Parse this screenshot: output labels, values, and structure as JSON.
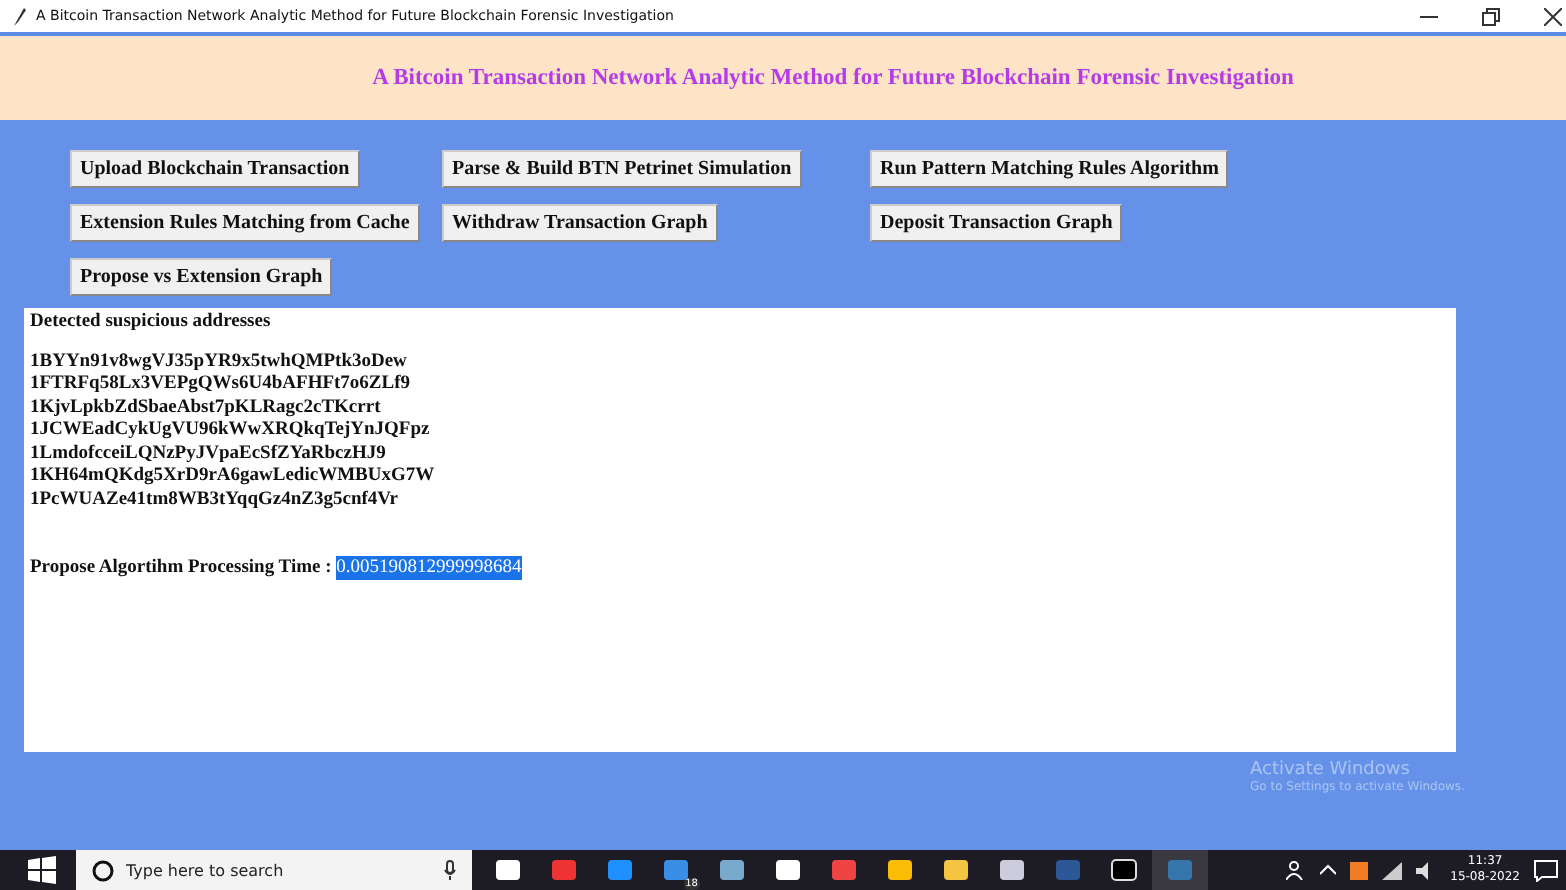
{
  "window": {
    "title": "A Bitcoin Transaction Network Analytic Method for Future Blockchain Forensic Investigation"
  },
  "header": {
    "title": "A Bitcoin Transaction Network Analytic Method for Future Blockchain Forensic Investigation"
  },
  "buttons": [
    {
      "label": "Upload Blockchain Transaction"
    },
    {
      "label": "Parse & Build BTN Petrinet Simulation"
    },
    {
      "label": "Run Pattern Matching Rules Algorithm"
    },
    {
      "label": "Extension Rules Matching from Cache"
    },
    {
      "label": "Withdraw Transaction Graph"
    },
    {
      "label": "Deposit Transaction Graph"
    },
    {
      "label": "Propose vs Extension Graph"
    }
  ],
  "output": {
    "heading": "Detected suspicious addresses",
    "addresses": [
      "1BYYn91v8wgVJ35pYR9x5twhQMPtk3oDew",
      "1FTRFq58Lx3VEPgQWs6U4bAFHFt7o6ZLf9",
      "1KjvLpkbZdSbaeAbst7pKLRagc2cTKcrrt",
      "1JCWEadCykUgVU96kWwXRQkqTejYnJQFpz",
      "1LmdofcceiLQNzPyJVpaEcSfZYaRbczHJ9",
      "1KH64mQKdg5XrD9rA6gawLedicWMBUxG7W",
      "1PcWUAZe41tm8WB3tYqqGz4nZ3g5cnf4Vr"
    ],
    "time_label": "Propose Algortihm Processing Time : ",
    "time_value": "0.005190812999998684"
  },
  "activation": {
    "title": "Activate Windows",
    "subtitle": "Go to Settings to activate Windows."
  },
  "taskbar": {
    "search_placeholder": "Type here to search",
    "mail_badge": "18",
    "time": "11:37",
    "date": "15-08-2022"
  }
}
